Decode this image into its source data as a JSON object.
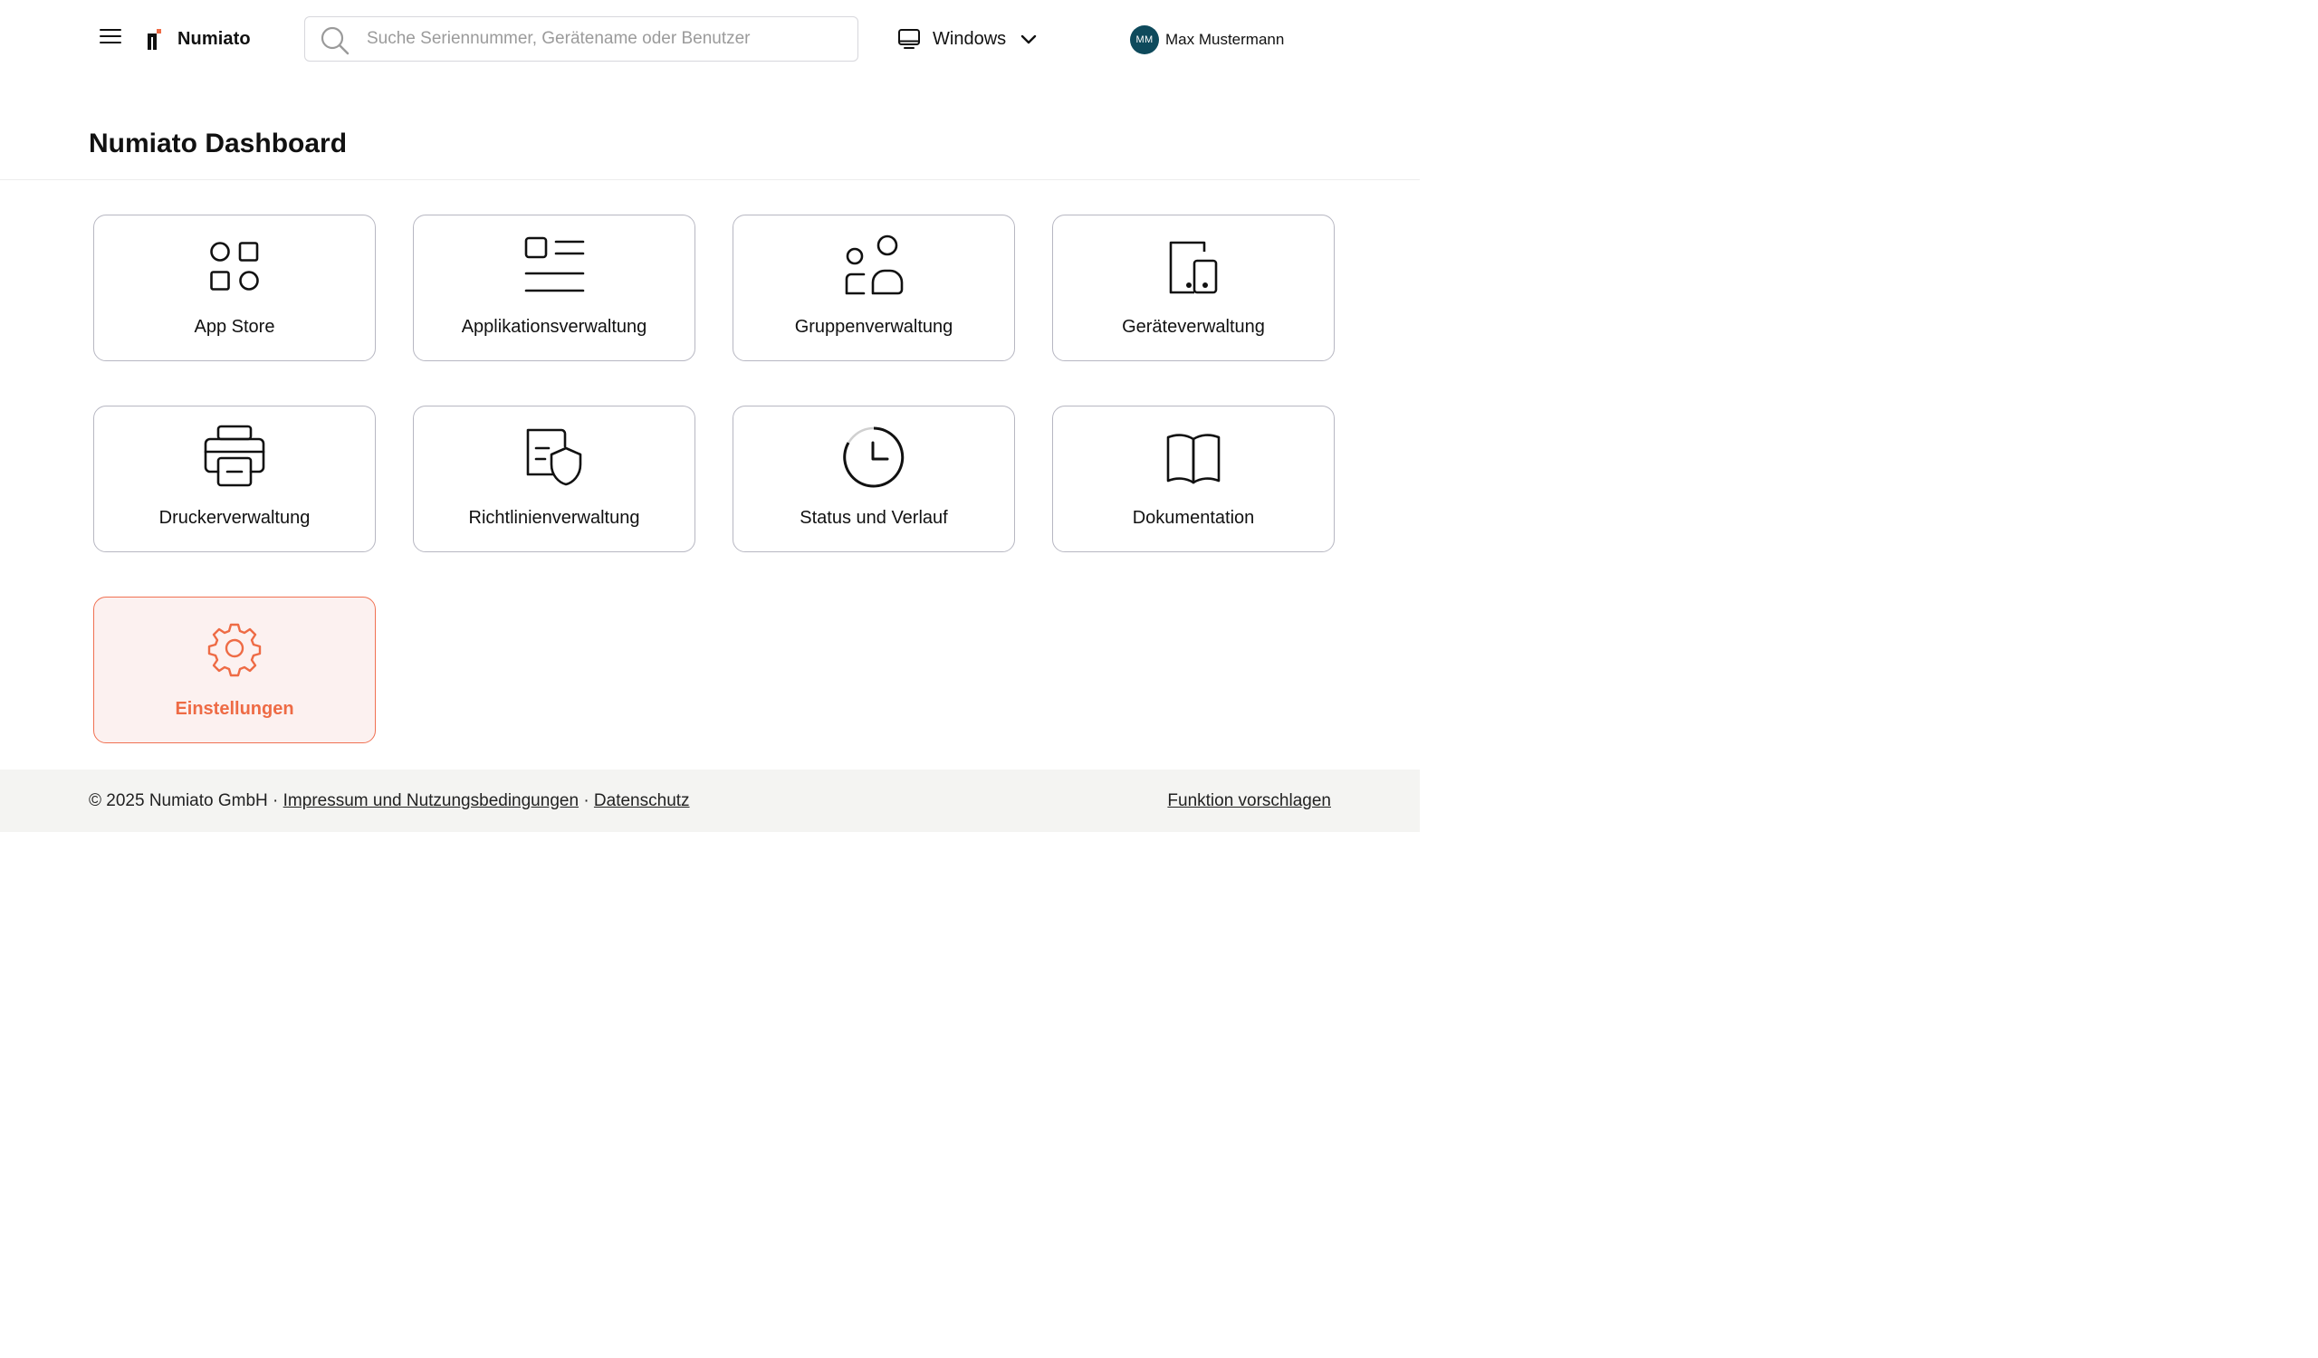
{
  "header": {
    "app_name": "Numiato",
    "search": {
      "placeholder": "Suche Seriennummer, Gerätename oder Benutzer",
      "value": ""
    },
    "os_selector": {
      "label": "Windows"
    },
    "user": {
      "initials": "MM",
      "name": "Max Mustermann"
    }
  },
  "page": {
    "title": "Numiato Dashboard"
  },
  "tiles": [
    {
      "label": "App Store",
      "icon": "app-store-icon"
    },
    {
      "label": "Applikationsverwaltung",
      "icon": "app-list-icon"
    },
    {
      "label": "Gruppenverwaltung",
      "icon": "group-icon"
    },
    {
      "label": "Geräteverwaltung",
      "icon": "devices-icon"
    },
    {
      "label": "Druckerverwaltung",
      "icon": "printer-icon"
    },
    {
      "label": "Richtlinienverwaltung",
      "icon": "policy-shield-icon"
    },
    {
      "label": "Status und Verlauf",
      "icon": "clock-icon"
    },
    {
      "label": "Dokumentation",
      "icon": "book-icon"
    },
    {
      "label": "Einstellungen",
      "icon": "gear-icon",
      "active": true
    }
  ],
  "footer": {
    "copyright": "© 2025 Numiato GmbH",
    "separator": "·",
    "imprint_link": "Impressum und Nutzungsbedingungen",
    "privacy_link": "Datenschutz",
    "suggest_link": "Funktion vorschlagen"
  },
  "colors": {
    "accent": "#ee6b45",
    "avatar": "#0e4a5c",
    "tile_border": "#b7b7c2",
    "active_tile_bg": "#fcf1f0"
  }
}
